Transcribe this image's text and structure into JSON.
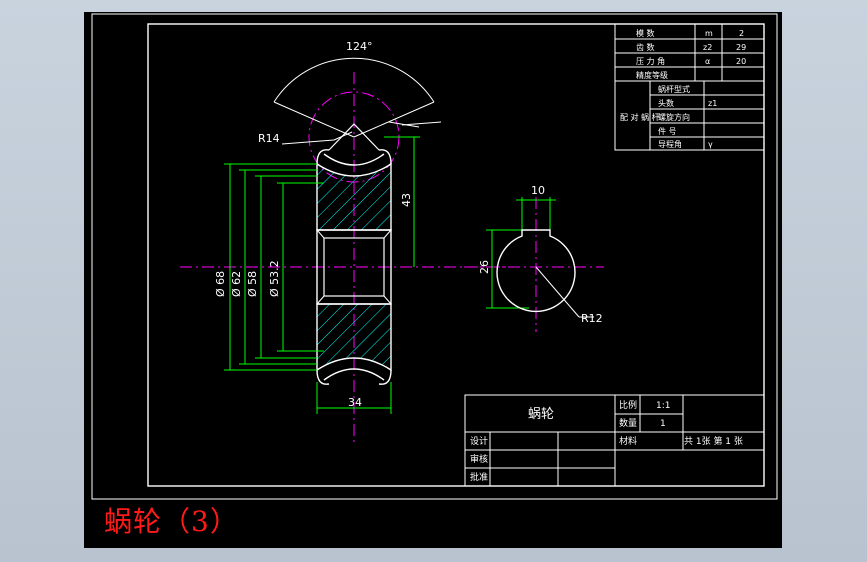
{
  "caption": "蜗轮（3）",
  "colors": {
    "background": "#000000",
    "frame": "#ffffff",
    "dimension": "#00ff00",
    "centerline": "#ff00ff",
    "hatch": "#00ffff",
    "caption": "#ff1a1a"
  },
  "dimensions": {
    "angle": "124°",
    "radius_top": "R14",
    "height": "43",
    "dia_68": "Ø 68",
    "dia_62": "Ø 62",
    "dia_58": "Ø 58",
    "dia_53": "Ø 53.2",
    "width": "34",
    "key_width": "10",
    "bore": "26",
    "radius_bore": "R12"
  },
  "param_table": {
    "rows": [
      {
        "label": "模    数",
        "symbol": "m",
        "value": "2"
      },
      {
        "label": "齿    数",
        "symbol": "z2",
        "value": "29"
      },
      {
        "label": "压 力 角",
        "symbol": "α",
        "value": "20"
      },
      {
        "label": "精度等级",
        "symbol": "",
        "value": ""
      }
    ],
    "group_label": "配 对 蜗 杆",
    "group_rows": [
      {
        "label": "蜗杆型式",
        "symbol": ""
      },
      {
        "label": "头数",
        "symbol": "z1"
      },
      {
        "label": "螺旋方向",
        "symbol": ""
      },
      {
        "label": "件  号",
        "symbol": ""
      },
      {
        "label": "导程角",
        "symbol": "γ"
      }
    ]
  },
  "title_block": {
    "part_name": "蜗轮",
    "scale_label": "比例",
    "scale_value": "1:1",
    "qty_label": "数量",
    "qty_value": "1",
    "material_label": "材料",
    "sheets": "共  1张   第 1  张",
    "design_label": "设计",
    "review_label": "审核",
    "approve_label": "批准"
  }
}
